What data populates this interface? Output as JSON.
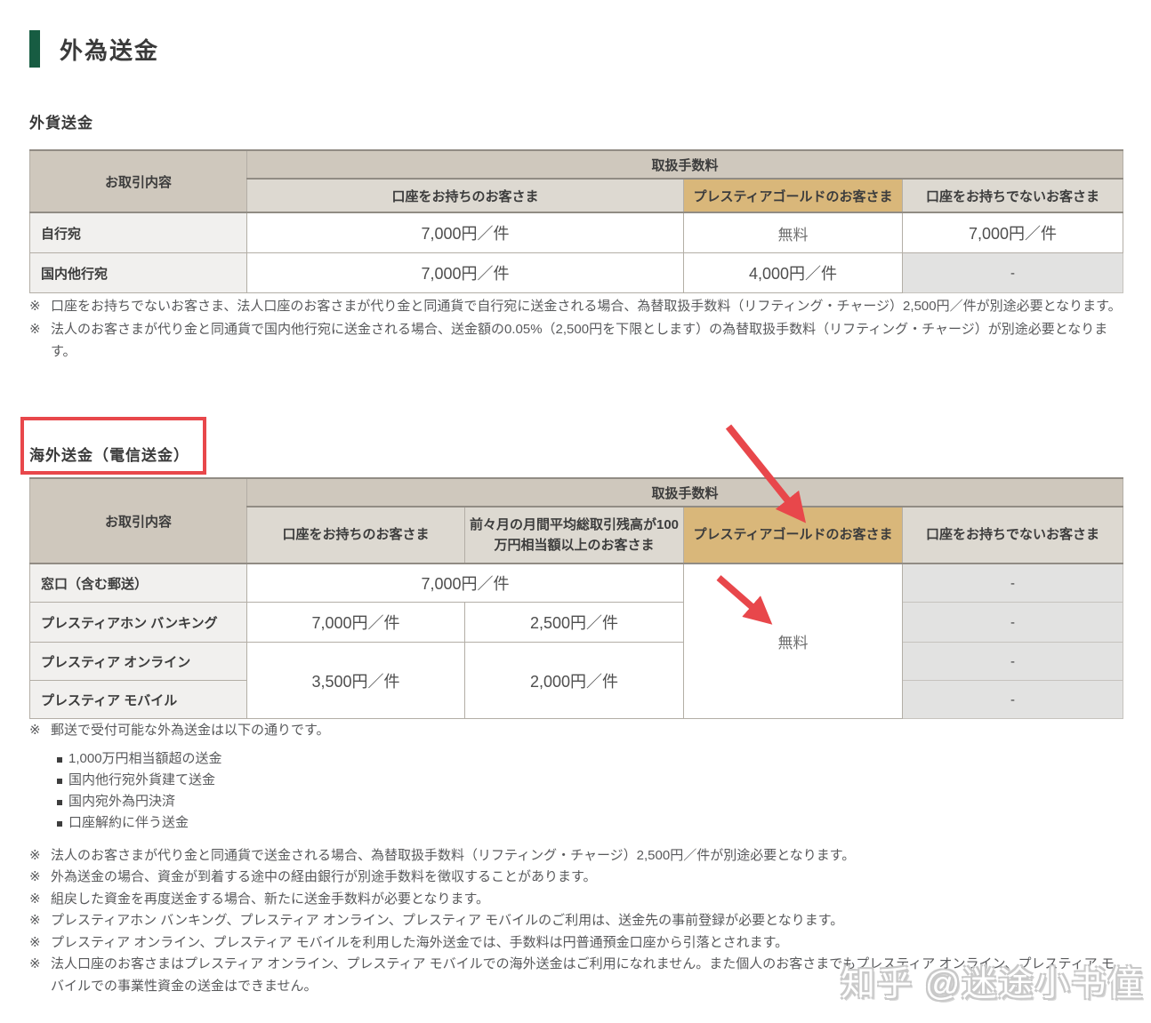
{
  "page_title": "外為送金",
  "colors": {
    "accent_green": "#175c42",
    "gold_highlight": "#d9b77a",
    "annotation_red": "#e8474b",
    "header_taupe": "#cfc8bd",
    "subheader_beige": "#ddd9d1"
  },
  "note_marker": "※",
  "watermark": "知乎 @迷途小书僮",
  "t1": {
    "heading": "外貨送金",
    "h_transaction": "お取引内容",
    "h_fee": "取扱手数料",
    "h_account": "口座をお持ちのお客さま",
    "h_gold": "プレスティアゴールドのお客さま",
    "h_noaccount": "口座をお持ちでないお客さま",
    "rows": [
      {
        "label": "自行宛",
        "account": "7,000円／件",
        "gold": "無料",
        "noaccount": "7,000円／件"
      },
      {
        "label": "国内他行宛",
        "account": "7,000円／件",
        "gold": "4,000円／件",
        "noaccount": "-"
      }
    ],
    "notes": [
      "口座をお持ちでないお客さま、法人口座のお客さまが代り金と同通貨で自行宛に送金される場合、為替取扱手数料（リフティング・チャージ）2,500円／件が別途必要となります。",
      "法人のお客さまが代り金と同通貨で国内他行宛に送金される場合、送金額の0.05%（2,500円を下限とします）の為替取扱手数料（リフティング・チャージ）が別途必要となります。"
    ]
  },
  "t2": {
    "heading": "海外送金（電信送金）",
    "h_transaction": "お取引内容",
    "h_fee": "取扱手数料",
    "h_account": "口座をお持ちのお客さま",
    "h_balance": "前々月の月間平均総取引残高が100万円相当額以上のお客さま",
    "h_gold": "プレスティアゴールドのお客さま",
    "h_noaccount": "口座をお持ちでないお客さま",
    "r1_label": "窓口（含む郵送）",
    "r1_fee": "7,000円／件",
    "r2_label": "プレスティアホン バンキング",
    "r2_account": "7,000円／件",
    "r2_balance": "2,500円／件",
    "r3_label": "プレスティア オンライン",
    "r4_label": "プレスティア モバイル",
    "r34_account": "3,500円／件",
    "r34_balance": "2,000円／件",
    "gold_value": "無料",
    "dash": "-"
  },
  "notes2": {
    "n1": "郵送で受付可能な外為送金は以下の通りです。",
    "bullets": [
      "1,000万円相当額超の送金",
      "国内他行宛外貨建て送金",
      "国内宛外為円決済",
      "口座解約に伴う送金"
    ],
    "n2": "法人のお客さまが代り金と同通貨で送金される場合、為替取扱手数料（リフティング・チャージ）2,500円／件が別途必要となります。",
    "n3": "外為送金の場合、資金が到着する途中の経由銀行が別途手数料を徴収することがあります。",
    "n4": "組戻した資金を再度送金する場合、新たに送金手数料が必要となります。",
    "n5": "プレスティアホン バンキング、プレスティア オンライン、プレスティア モバイルのご利用は、送金先の事前登録が必要となります。",
    "n6": "プレスティア オンライン、プレスティア モバイルを利用した海外送金では、手数料は円普通預金口座から引落とされます。",
    "n7": "法人口座のお客さまはプレスティア オンライン、プレスティア モバイルでの海外送金はご利用になれません。また個人のお客さまでもプレスティア オンライン、プレスティア モバイルでの事業性資金の送金はできません。"
  }
}
